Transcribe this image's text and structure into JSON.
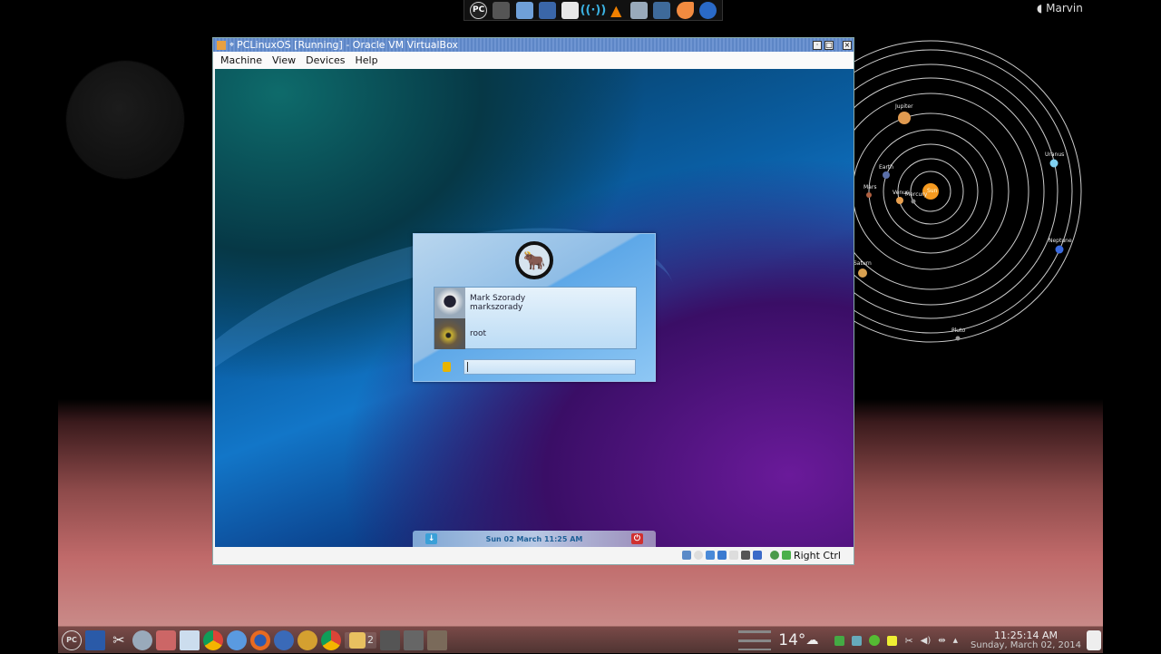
{
  "top_panel": {
    "icons": [
      "pclinuxos-icon",
      "gimp-icon",
      "file-manager-icon",
      "virtualbox-icon",
      "text-editor-icon",
      "network-icon",
      "vlc-icon",
      "media-icon",
      "display-icon",
      "clementine-icon",
      "browser-icon"
    ],
    "pc_label": "PC"
  },
  "user_name": "Marvin",
  "solar_system": {
    "sun": "Sun",
    "planets": [
      "Mercury",
      "Venus",
      "Earth",
      "Mars",
      "Jupiter",
      "Saturn",
      "Uranus",
      "Neptune",
      "Pluto"
    ]
  },
  "vbox": {
    "title": "PCLinuxOS [Running] - Oracle VM VirtualBox",
    "menu": [
      "Machine",
      "View",
      "Devices",
      "Help"
    ],
    "host_key": "Right Ctrl"
  },
  "login": {
    "users": [
      {
        "name": "Mark Szorady",
        "login": "markszorady"
      },
      {
        "name": "root"
      }
    ],
    "password": "",
    "datetime": "Sun 02 March 11:25 AM"
  },
  "taskbar": {
    "start_label": "PC",
    "group_count": "2",
    "weather": "14°",
    "time": "11:25:14 AM",
    "date": "Sunday, March 02, 2014"
  }
}
